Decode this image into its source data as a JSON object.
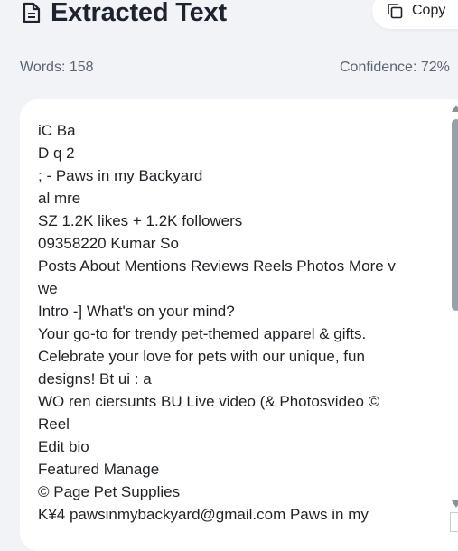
{
  "header": {
    "title": "Extracted Text",
    "title_icon": "document-icon",
    "copy_label": "Copy",
    "copy_icon": "copy-icon"
  },
  "stats": {
    "words": "Words: 158",
    "confidence": "Confidence: 72%"
  },
  "extracted_lines": [
    "iC Ba",
    "D q 2",
    "; - Paws in my Backyard",
    "al mre",
    "SZ 1.2K likes + 1.2K followers",
    "09358220 Kumar So",
    "Posts About Mentions Reviews Reels Photos More v",
    "we",
    "Intro -] What's on your mind?",
    "Your go-to for trendy pet-themed apparel & gifts.",
    "Celebrate your love for pets with our unique, fun",
    "designs! Bt ui : a",
    "WO ren ciersunts BU Live video (& Photosvideo ©",
    "Reel",
    "Edit bio",
    "Featured Manage",
    "© Page Pet Supplies",
    "K¥4 pawsinmybackyard@gmail.com Paws in my"
  ],
  "colors": {
    "background": "#f1f3f6",
    "card": "#ffffff",
    "title": "#1e2330",
    "muted": "#5b6573"
  }
}
